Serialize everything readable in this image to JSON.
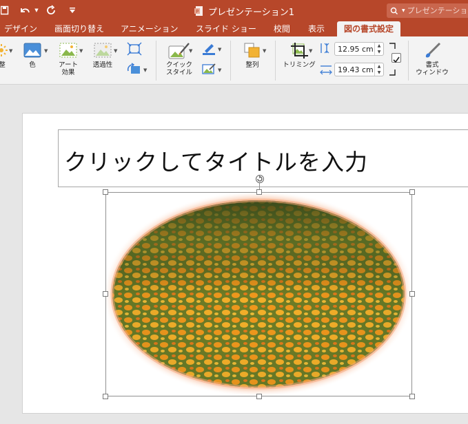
{
  "app": {
    "document_title": "プレゼンテーション1",
    "search_placeholder": "プレゼンテーション"
  },
  "tabs": [
    {
      "label": "デザイン",
      "active": false
    },
    {
      "label": "画面切り替え",
      "active": false
    },
    {
      "label": "アニメーション",
      "active": false
    },
    {
      "label": "スライド ショー",
      "active": false
    },
    {
      "label": "校閲",
      "active": false
    },
    {
      "label": "表示",
      "active": false
    },
    {
      "label": "図の書式設定",
      "active": true
    }
  ],
  "ribbon": {
    "adjust_label": "整",
    "color_label": "色",
    "artistic_label_1": "アート",
    "artistic_label_2": "効果",
    "transparency_label": "透過性",
    "quick_styles_label_1": "クイック",
    "quick_styles_label_2": "スタイル",
    "arrange_label": "整列",
    "crop_label": "トリミング",
    "height_value": "12.95 cm",
    "width_value": "19.43 cm",
    "format_pane_label_1": "書式",
    "format_pane_label_2": "ウィンドウ"
  },
  "slide": {
    "title_placeholder": "クリックしてタイトルを入力"
  },
  "colors": {
    "accent": "#b7472a",
    "ribbon_bg": "#f3f3f3",
    "workspace_bg": "#e6e6e6"
  }
}
